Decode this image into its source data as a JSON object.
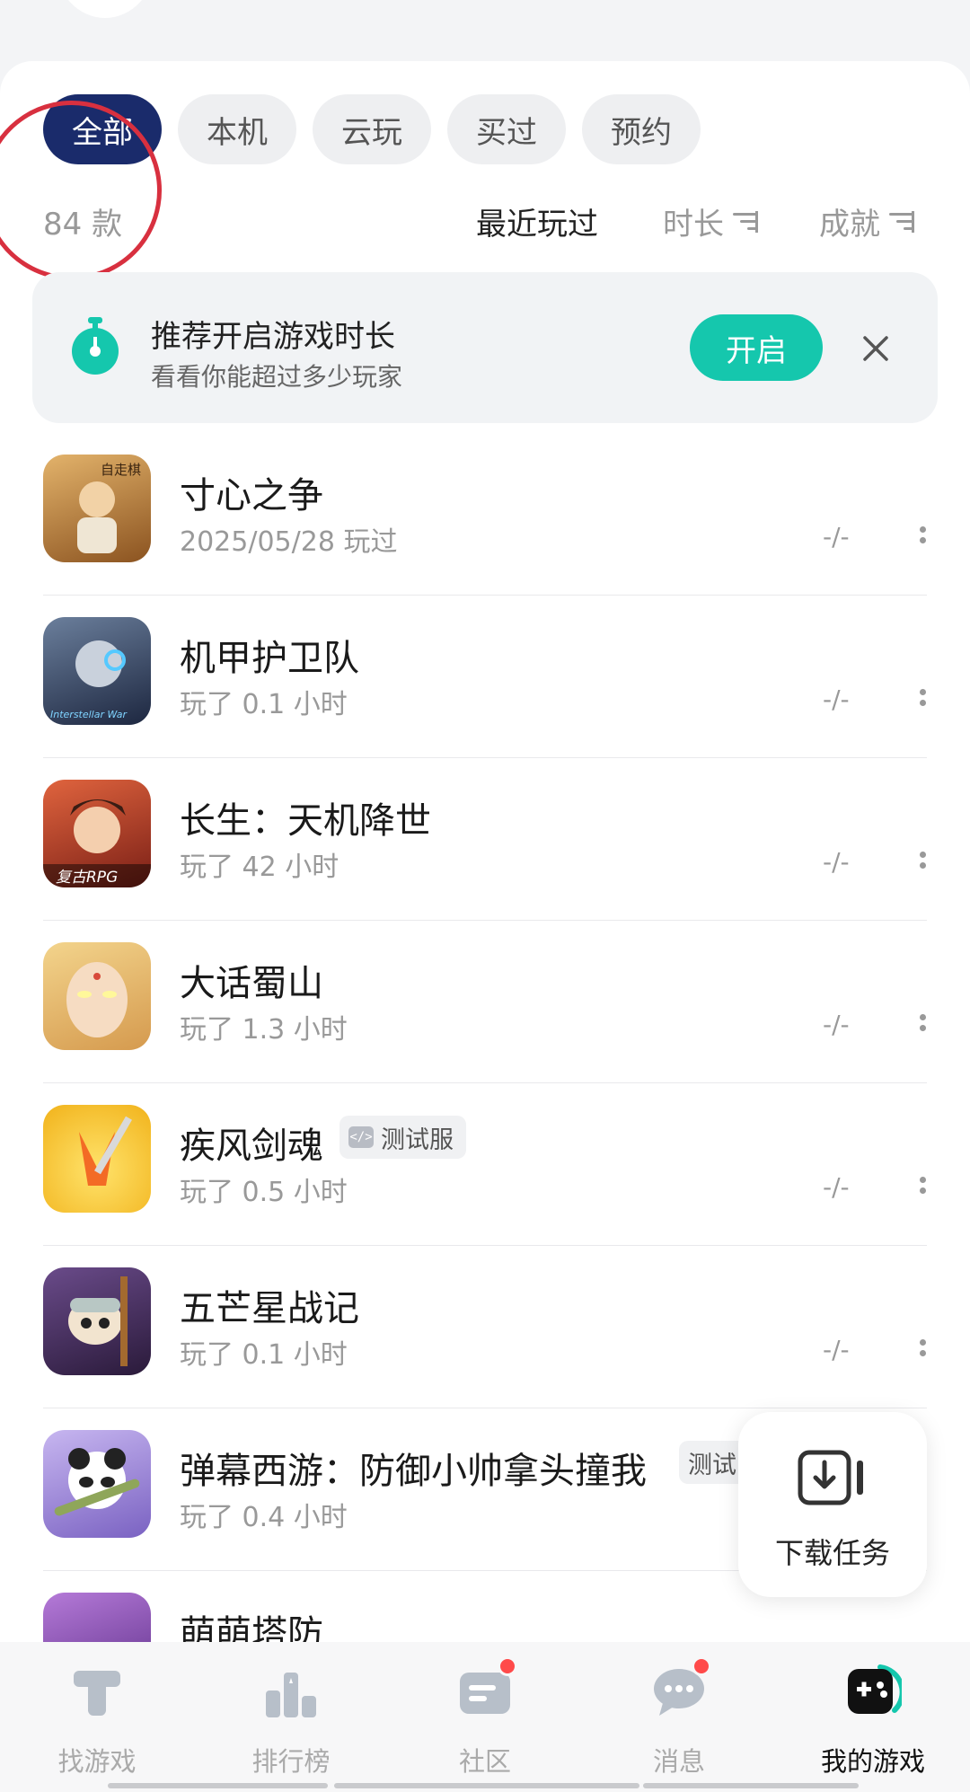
{
  "filters": {
    "tabs": [
      "全部",
      "本机",
      "云玩",
      "买过",
      "预约"
    ]
  },
  "summary": {
    "count": "84 款"
  },
  "sort": {
    "recent": "最近玩过",
    "duration": "时长",
    "achievement": "成就"
  },
  "banner": {
    "title": "推荐开启游戏时长",
    "subtitle": "看看你能超过多少玩家",
    "button": "开启"
  },
  "games": [
    {
      "name": "寸心之争",
      "subtitle": "2025/05/28 玩过",
      "achievement": "-/-",
      "tag": "",
      "thumb_color": "#c98a3e",
      "thumb_text": "自走棋"
    },
    {
      "name": "机甲护卫队",
      "subtitle": "玩了 0.1 小时",
      "achievement": "-/-",
      "tag": "",
      "thumb_color": "#2b3a55",
      "thumb_text": "Interstellar War"
    },
    {
      "name": "长生：天机降世",
      "subtitle": "玩了 42 小时",
      "achievement": "-/-",
      "tag": "",
      "thumb_color": "#b5432e",
      "thumb_text": "复古RPG"
    },
    {
      "name": "大话蜀山",
      "subtitle": "玩了 1.3 小时",
      "achievement": "-/-",
      "tag": "",
      "thumb_color": "#e7b978",
      "thumb_text": ""
    },
    {
      "name": "疾风剑魂",
      "subtitle": "玩了 0.5 小时",
      "achievement": "-/-",
      "tag": "测试服",
      "thumb_color": "#f3c21d",
      "thumb_text": ""
    },
    {
      "name": "五芒星战记",
      "subtitle": "玩了 0.1 小时",
      "achievement": "-/-",
      "tag": "",
      "thumb_color": "#5a3b6e",
      "thumb_text": ""
    },
    {
      "name": "弹幕西游：防御小帅拿头撞我",
      "subtitle": "玩了 0.4 小时",
      "achievement": "",
      "tag": "测试",
      "thumb_color": "#9a86d1",
      "thumb_text": ""
    },
    {
      "name": "萌萌塔防",
      "subtitle": "",
      "achievement": "",
      "tag": "",
      "thumb_color": "#8c5cb8",
      "thumb_text": ""
    }
  ],
  "download": {
    "label": "下载任务"
  },
  "tabbar": {
    "items": [
      {
        "label": "找游戏",
        "icon": "find-game-icon"
      },
      {
        "label": "排行榜",
        "icon": "ranking-icon"
      },
      {
        "label": "社区",
        "icon": "community-icon"
      },
      {
        "label": "消息",
        "icon": "message-icon"
      },
      {
        "label": "我的游戏",
        "icon": "my-games-icon"
      }
    ]
  },
  "colors": {
    "accent": "#15c7ad",
    "active_chip": "#1a2b6b",
    "badge": "#ff4a4a",
    "annotation": "#d8303f"
  }
}
